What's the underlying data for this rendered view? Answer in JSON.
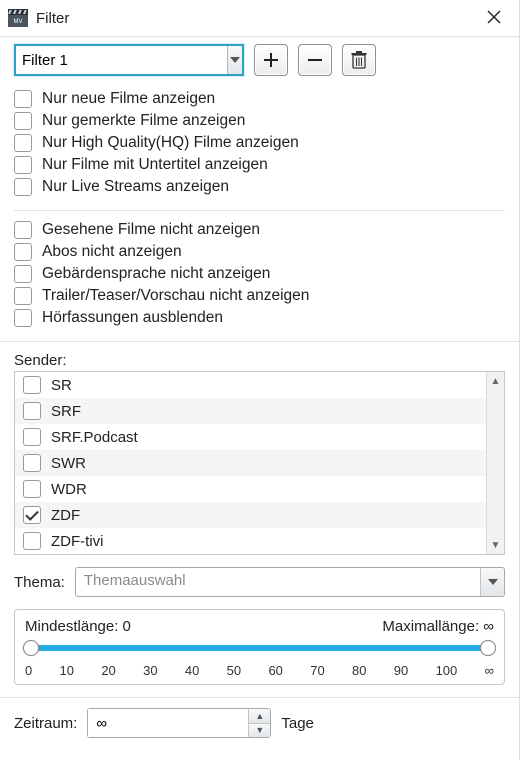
{
  "window": {
    "title": "Filter",
    "icon": "clapperboard-icon"
  },
  "toolbar": {
    "filter_combo_value": "Filter 1",
    "add_label": "+",
    "remove_label": "−",
    "delete_label": "🗑"
  },
  "checks_group1": [
    {
      "label": "Nur neue Filme anzeigen",
      "checked": false
    },
    {
      "label": "Nur gemerkte Filme anzeigen",
      "checked": false
    },
    {
      "label": "Nur High Quality(HQ) Filme anzeigen",
      "checked": false
    },
    {
      "label": "Nur Filme mit Untertitel anzeigen",
      "checked": false
    },
    {
      "label": "Nur Live Streams anzeigen",
      "checked": false
    }
  ],
  "checks_group2": [
    {
      "label": "Gesehene Filme nicht anzeigen",
      "checked": false
    },
    {
      "label": "Abos nicht anzeigen",
      "checked": false
    },
    {
      "label": "Gebärdensprache nicht anzeigen",
      "checked": false
    },
    {
      "label": "Trailer/Teaser/Vorschau nicht anzeigen",
      "checked": false
    },
    {
      "label": "Hörfassungen ausblenden",
      "checked": false
    }
  ],
  "sender": {
    "label": "Sender:",
    "items": [
      {
        "label": "SR",
        "checked": false
      },
      {
        "label": "SRF",
        "checked": false
      },
      {
        "label": "SRF.Podcast",
        "checked": false
      },
      {
        "label": "SWR",
        "checked": false
      },
      {
        "label": "WDR",
        "checked": false
      },
      {
        "label": "ZDF",
        "checked": true
      },
      {
        "label": "ZDF-tivi",
        "checked": false
      }
    ]
  },
  "thema": {
    "label": "Thema:",
    "placeholder": "Themaauswahl"
  },
  "length_slider": {
    "min_label": "Mindestlänge: 0",
    "max_label": "Maximallänge: ∞",
    "ticks": [
      "0",
      "10",
      "20",
      "30",
      "40",
      "50",
      "60",
      "70",
      "80",
      "90",
      "100",
      "∞"
    ]
  },
  "zeitraum": {
    "label": "Zeitraum:",
    "value": "∞",
    "unit": "Tage"
  }
}
